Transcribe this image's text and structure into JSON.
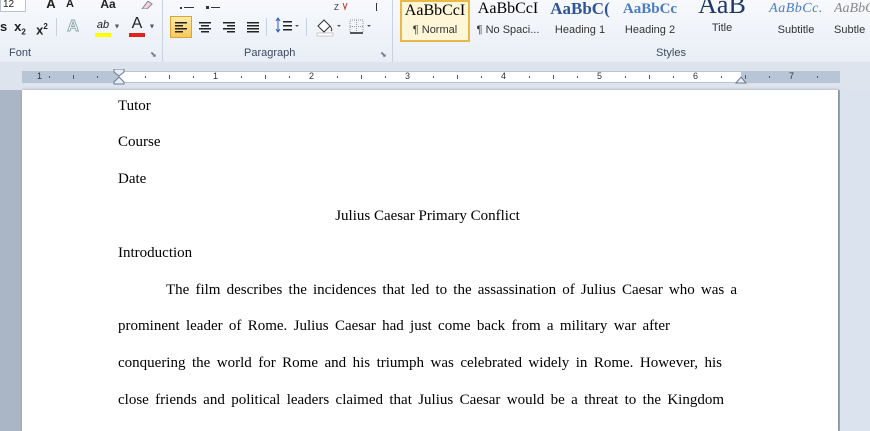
{
  "ribbon": {
    "font": {
      "label": "Font",
      "size_value": "12",
      "grow_label": "A",
      "shrink_label": "A",
      "change_case_label": "Aa",
      "subscript_label": "x",
      "subscript_sub": "2",
      "superscript_label": "x",
      "superscript_sup": "2",
      "text_effects_label": "A",
      "highlight_label": "ab",
      "font_color_label": "A",
      "highlight_color": "#ffff00",
      "font_color": "#e0231c",
      "partial_left": "s"
    },
    "paragraph": {
      "label": "Paragraph"
    },
    "styles": {
      "label": "Styles",
      "tiles": [
        {
          "sample": "AaBbCcI",
          "name": "¶ Normal"
        },
        {
          "sample": "AaBbCcI",
          "name": "¶ No Spaci..."
        },
        {
          "sample": "AaBbC(",
          "name": "Heading 1"
        },
        {
          "sample": "AaBbCc",
          "name": "Heading 2"
        },
        {
          "sample": "AaB",
          "name": "Title"
        },
        {
          "sample": "AaBbCc.",
          "name": "Subtitle"
        },
        {
          "sample": "AaBbC",
          "name": "Subtle"
        }
      ]
    }
  },
  "ruler": {
    "numbers": [
      "1",
      "1",
      "2",
      "3",
      "4",
      "5",
      "6",
      "7"
    ]
  },
  "document": {
    "lines": [
      "Tutor",
      "Course",
      "Date",
      "Julius Caesar Primary Conflict",
      "Introduction",
      "The film describes the incidences that led to the assassination of Julius Caesar who was a",
      "prominent leader of Rome. Julius Caesar had just come back from a military war after",
      "conquering the world for Rome and his triumph was celebrated widely in Rome. However, his",
      "close friends and political leaders claimed that Julius Caesar would be a threat to the Kingdom"
    ]
  }
}
